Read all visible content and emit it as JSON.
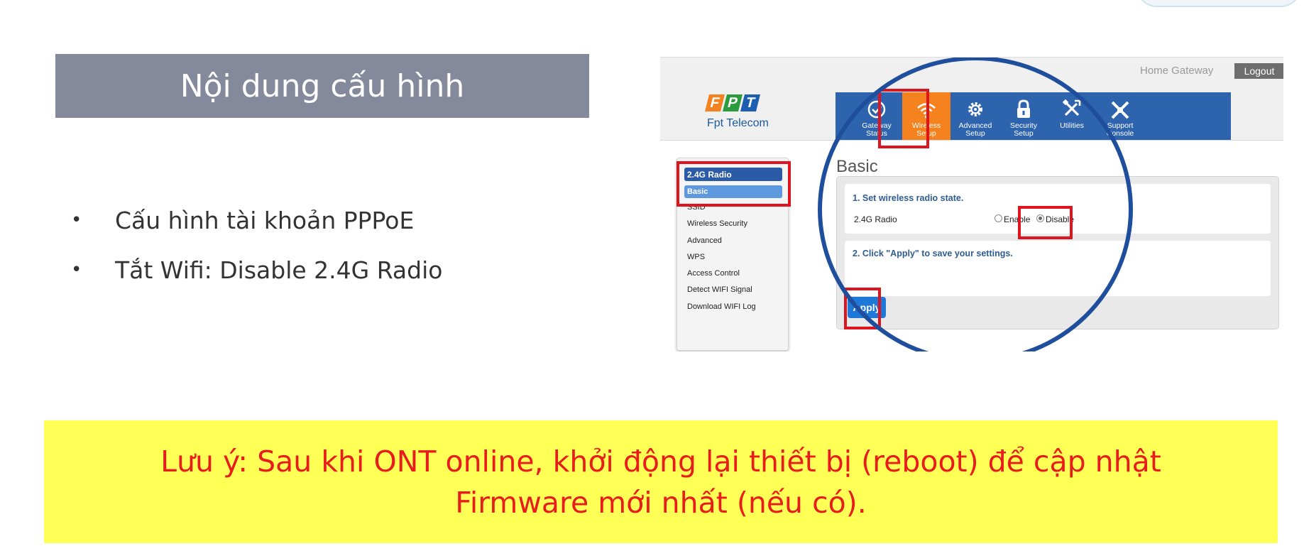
{
  "slide": {
    "heading": "Nội dung cấu hình",
    "bullets": [
      "Cấu hình tài khoản PPPoE",
      "Tắt Wifi: Disable 2.4G Radio"
    ],
    "bullet_char": "•",
    "note_line1": "Lưu ý: Sau khi ONT online, khởi động lại thiết bị (reboot) để cập nhật",
    "note_line2": "Firmware mới nhất (nếu có)."
  },
  "router": {
    "header_title": "Home Gateway",
    "logout": "Logout",
    "logo_letters": [
      "F",
      "P",
      "T"
    ],
    "logo_name": "Fpt Telecom",
    "nav": [
      {
        "l1": "Gateway",
        "l2": "Status",
        "icon": "check-circle-icon"
      },
      {
        "l1": "Wireless",
        "l2": "Setup",
        "icon": "wifi-icon"
      },
      {
        "l1": "Advanced",
        "l2": "Setup",
        "icon": "gear-icon"
      },
      {
        "l1": "Security",
        "l2": "Setup",
        "icon": "lock-icon"
      },
      {
        "l1": "Utilities",
        "l2": "",
        "icon": "tools-icon"
      },
      {
        "l1": "Support",
        "l2": "Console",
        "icon": "support-icon"
      }
    ],
    "sidebar": {
      "section": "2.4G Radio",
      "selected": "Basic",
      "items": [
        "SSID",
        "Wireless Security",
        "Advanced",
        "WPS",
        "Access Control",
        "Detect WIFI Signal",
        "Download WIFI Log"
      ]
    },
    "page_title": "Basic",
    "step1": "1. Set wireless radio state.",
    "radio_label": "2.4G Radio",
    "enable": "Enable",
    "disable": "Disable",
    "radio_state": "Disable",
    "step2": "2. Click \"Apply\" to save your settings.",
    "apply": "Apply"
  },
  "colors": {
    "title_bg": "#848a9b",
    "note_bg": "#ffff55",
    "note_text": "#e81c1c",
    "nav_bg": "#2e63ae",
    "nav_active": "#f5811f",
    "highlight": "#e0141e",
    "circle": "#1f4f9c",
    "logo_colors": [
      "#f58220",
      "#2b9b3c",
      "#1c5fb0"
    ]
  }
}
